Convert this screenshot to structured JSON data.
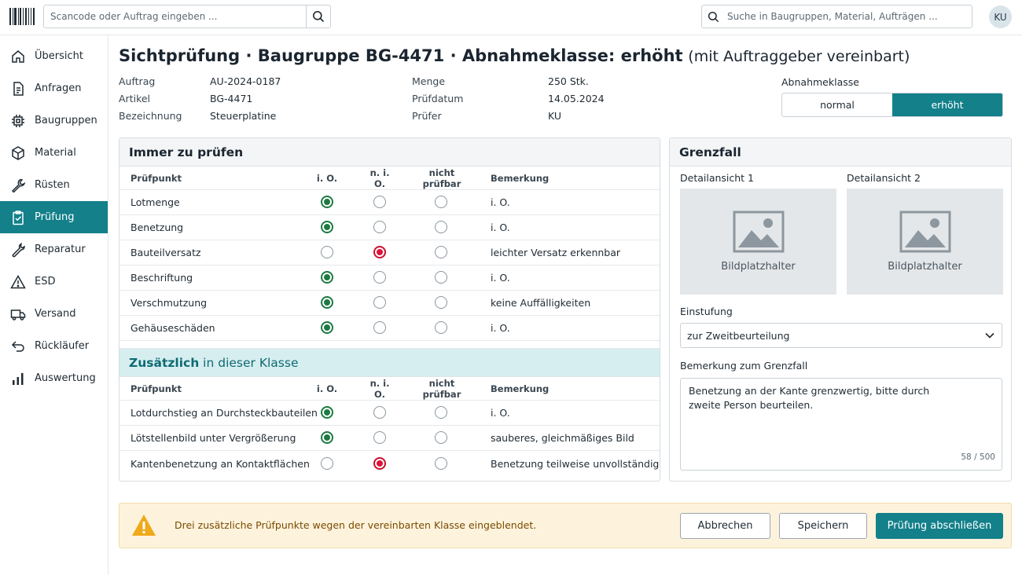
{
  "topbar": {
    "scan_placeholder": "Scancode oder Auftrag eingeben ...",
    "search_placeholder": "Suche in Baugruppen, Material, Aufträgen ...",
    "user_initials": "KU"
  },
  "sidebar": {
    "items": [
      {
        "label": "Übersicht",
        "icon": "home-icon"
      },
      {
        "label": "Anfragen",
        "icon": "document-icon"
      },
      {
        "label": "Baugruppen",
        "icon": "chip-icon"
      },
      {
        "label": "Material",
        "icon": "box-icon"
      },
      {
        "label": "Rüsten",
        "icon": "wrench-icon"
      },
      {
        "label": "Prüfung",
        "icon": "clipboard-check-icon",
        "active": true
      },
      {
        "label": "Reparatur",
        "icon": "repair-icon"
      },
      {
        "label": "ESD",
        "icon": "warning-icon"
      },
      {
        "label": "Versand",
        "icon": "truck-icon"
      },
      {
        "label": "Rückläufer",
        "icon": "return-icon"
      },
      {
        "label": "Auswertung",
        "icon": "bar-chart-icon"
      }
    ]
  },
  "page": {
    "title_main": "Sichtprüfung · Baugruppe BG-4471 · Abnahmeklasse: erhöht",
    "title_sub": "(mit Auftraggeber vereinbart)"
  },
  "meta": {
    "left": [
      {
        "k": "Auftrag",
        "v": "AU-2024-0187"
      },
      {
        "k": "Artikel",
        "v": "BG-4471"
      },
      {
        "k": "Bezeichnung",
        "v": "Steuerplatine"
      }
    ],
    "right": [
      {
        "k": "Menge",
        "v": "250 Stk."
      },
      {
        "k": "Prüfdatum",
        "v": "14.05.2024"
      },
      {
        "k": "Prüfer",
        "v": "KU"
      }
    ]
  },
  "klasse": {
    "label": "Abnahmeklasse",
    "options": [
      "normal",
      "erhöht"
    ],
    "selected": "erhöht"
  },
  "columns": {
    "name": "Prüfpunkt",
    "io": "i. O.",
    "nio": "n. i. O.",
    "np": "nicht prüfbar",
    "remark": "Bemerkung"
  },
  "section_always": {
    "title": "Immer zu prüfen",
    "rows": [
      {
        "name": "Lotmenge",
        "state": "io",
        "remark": "i. O."
      },
      {
        "name": "Benetzung",
        "state": "io",
        "remark": "i. O."
      },
      {
        "name": "Bauteilversatz",
        "state": "nio",
        "remark": "leichter Versatz erkennbar"
      },
      {
        "name": "Beschriftung",
        "state": "io",
        "remark": "i. O."
      },
      {
        "name": "Verschmutzung",
        "state": "io",
        "remark": "keine Auffälligkeiten"
      },
      {
        "name": "Gehäuseschäden",
        "state": "io",
        "remark": "i. O."
      }
    ]
  },
  "section_extra": {
    "title_prefix": "Zusätzlich",
    "title_suffix": " in dieser Klasse",
    "rows": [
      {
        "name": "Lotdurchstieg an Durchsteckbauteilen",
        "state": "io",
        "remark": "i. O."
      },
      {
        "name": "Lötstellenbild unter Vergrößerung",
        "state": "io",
        "remark": "sauberes, gleichmäßiges Bild"
      },
      {
        "name": "Kantenbenetzung an Kontaktflächen",
        "state": "nio",
        "remark": "Benetzung teilweise unvollständig"
      }
    ]
  },
  "grenzfall": {
    "title": "Grenzfall",
    "detail1": "Detailansicht 1",
    "detail2": "Detailansicht 2",
    "placeholder": "Bildplatzhalter",
    "einstufung_label": "Einstufung",
    "einstufung_value": "zur Zweitbeurteilung",
    "bemerkung_label": "Bemerkung zum Grenzfall",
    "bemerkung_text": "Benetzung an der Kante grenzwertig, bitte durch zweite Person beurteilen.",
    "counter": "58 / 500"
  },
  "footer": {
    "warning": "Drei zusätzliche Prüfpunkte wegen der vereinbarten Klasse eingeblendet.",
    "cancel": "Abbrechen",
    "save": "Speichern",
    "finish": "Prüfung abschließen"
  },
  "colors": {
    "accent": "#13808a",
    "ok": "#1d7a42",
    "not_ok": "#e0123a",
    "warning_bg": "#fdf3dd"
  }
}
